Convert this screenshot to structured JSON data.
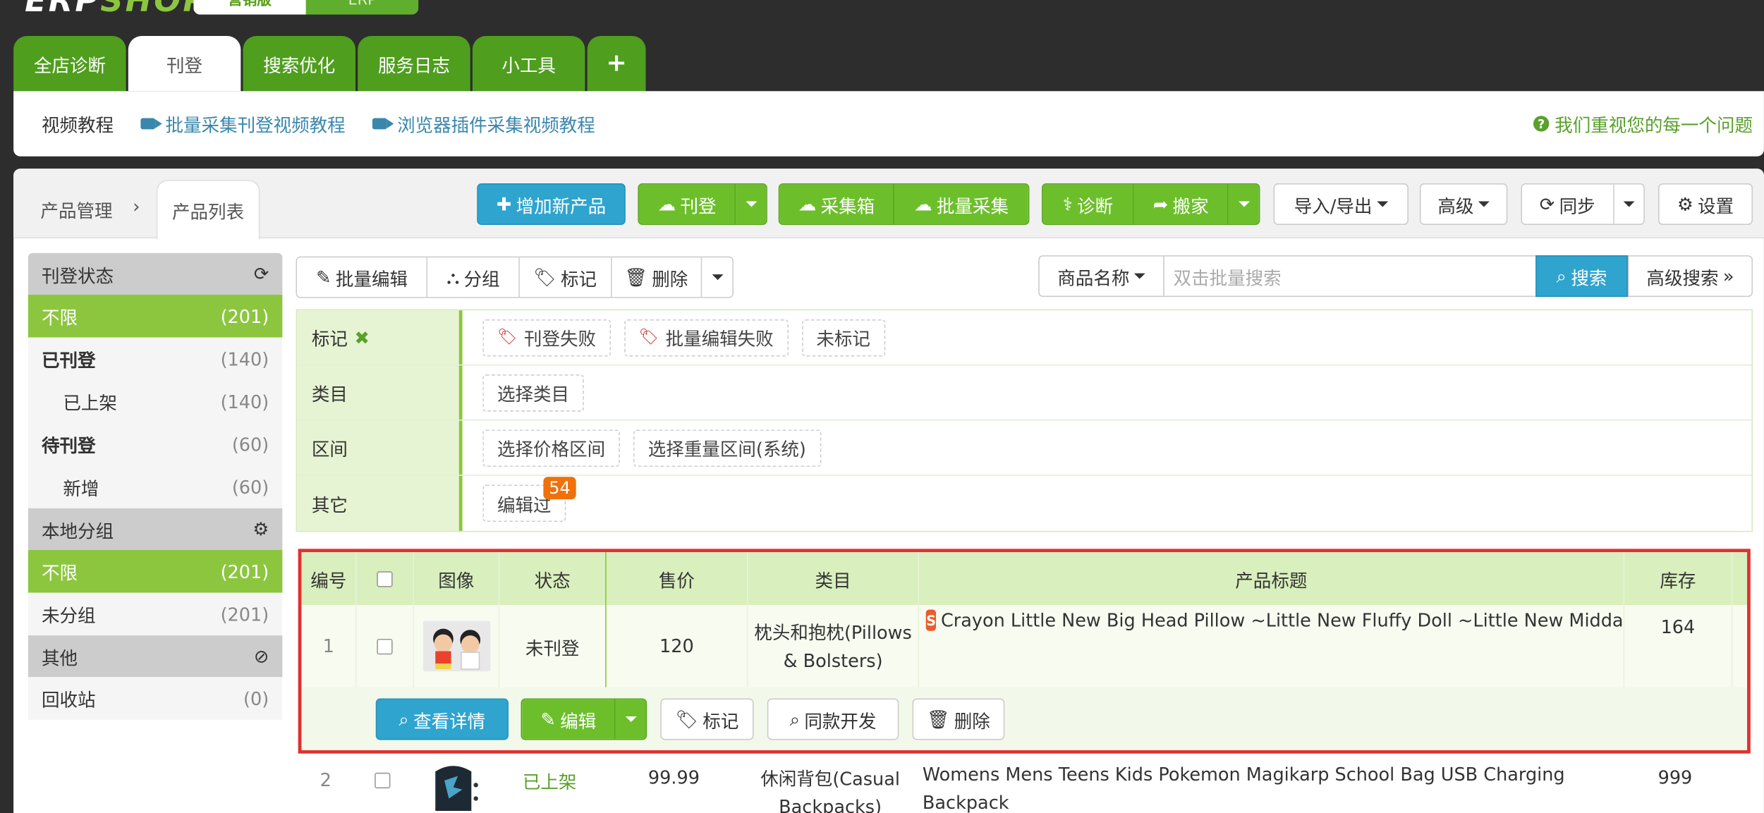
{
  "brand": {
    "edition_active": "营销版",
    "edition_other": "ERP"
  },
  "main_tabs": [
    "全店诊断",
    "刊登",
    "搜索优化",
    "服务日志",
    "小工具",
    "+"
  ],
  "tutorial": {
    "label": "视频教程",
    "link1": "批量采集刊登视频教程",
    "link2": "浏览器插件采集视频教程",
    "help": "我们重视您的每一个问题"
  },
  "breadcrumb": {
    "parent": "产品管理",
    "sep": "›",
    "current": "产品列表"
  },
  "toolbar": {
    "add_product": "增加新产品",
    "publish": "刊登",
    "collect_box": "采集箱",
    "batch_collect": "批量采集",
    "diagnose": "诊断",
    "move": "搬家",
    "import_export": "导入/导出",
    "advanced": "高级",
    "sync": "同步",
    "settings": "设置"
  },
  "actions": {
    "batch_edit": "批量编辑",
    "group": "分组",
    "mark": "标记",
    "delete": "删除"
  },
  "search": {
    "field": "商品名称",
    "placeholder": "双击批量搜索",
    "button": "搜索",
    "advanced": "高级搜索"
  },
  "sidebar": {
    "status_title": "刊登状态",
    "status_items": [
      {
        "label": "不限",
        "count": "(201)"
      },
      {
        "label": "已刊登",
        "count": "(140)"
      },
      {
        "label": "已上架",
        "count": "(140)"
      },
      {
        "label": "待刊登",
        "count": "(60)"
      },
      {
        "label": "新增",
        "count": "(60)"
      }
    ],
    "group_title": "本地分组",
    "group_items": [
      {
        "label": "不限",
        "count": "(201)"
      },
      {
        "label": "未分组",
        "count": "(201)"
      }
    ],
    "other_title": "其他",
    "other_items": [
      {
        "label": "回收站",
        "count": "(0)"
      }
    ]
  },
  "filters": {
    "mark": {
      "key": "标记",
      "values": [
        "刊登失败",
        "批量编辑失败",
        "未标记"
      ]
    },
    "category": {
      "key": "类目",
      "values": [
        "选择类目"
      ]
    },
    "range": {
      "key": "区间",
      "values": [
        "选择价格区间",
        "选择重量区间(系统)"
      ]
    },
    "other": {
      "key": "其它",
      "values": [
        "编辑过"
      ],
      "badge": "54"
    }
  },
  "table": {
    "headers": [
      "编号",
      "",
      "图像",
      "状态",
      "售价",
      "类目",
      "产品标题",
      "库存"
    ],
    "rows": [
      {
        "no": "1",
        "status": "未刊登",
        "price": "120",
        "category": "枕头和抱枕(Pillows & Bolsters)",
        "title": "Crayon Little New Big Head Pillow ~Little New Fluffy Doll ~Little New Midda",
        "stock": "164"
      },
      {
        "no": "2",
        "status": "已上架",
        "price": "99.99",
        "category": "休闲背包(Casual Backpacks)",
        "title": "Womens Mens Teens Kids Pokemon Magikarp School Bag USB Charging Backpack",
        "stock": "999"
      }
    ],
    "row_actions": {
      "view": "查看详情",
      "edit": "编辑",
      "mark": "标记",
      "similar": "同款开发",
      "delete": "删除"
    }
  },
  "colors": {
    "green": "#6cbf2b",
    "blue": "#2fa4cf",
    "highlight_border": "#e03030",
    "dark_bg": "#2d2d2d"
  }
}
